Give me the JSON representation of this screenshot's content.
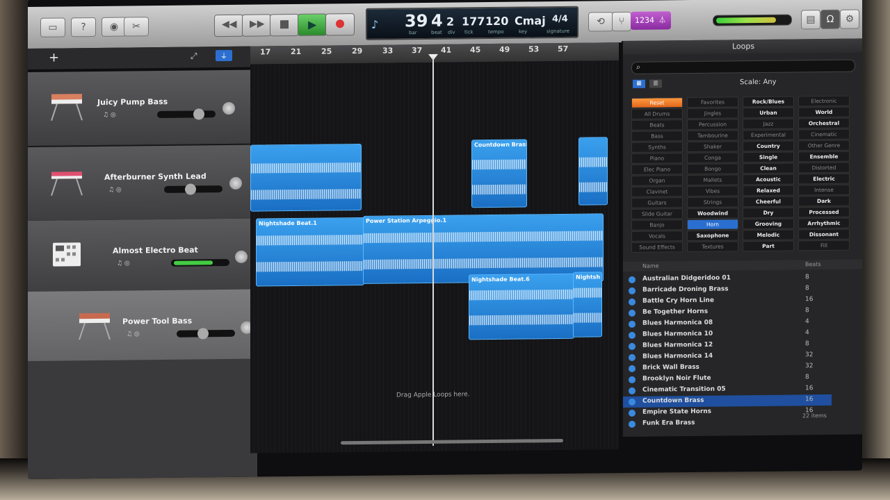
{
  "toolbar": {
    "lcd": {
      "bar": "39",
      "beat": "4",
      "div": "2",
      "tick": "177",
      "tempo": "120",
      "key": "Cmaj",
      "signature": "4/4",
      "bar_lbl": "bar",
      "beat_lbl": "beat",
      "div_lbl": "div",
      "tick_lbl": "tick",
      "tempo_lbl": "tempo",
      "key_lbl": "key",
      "sig_lbl": "signature"
    },
    "count_in": "1234"
  },
  "tracks": [
    {
      "name": "Juicy Pump Bass"
    },
    {
      "name": "Afterburner Synth Lead"
    },
    {
      "name": "Almost Electro Beat"
    },
    {
      "name": "Power Tool Bass"
    }
  ],
  "ruler": [
    "17",
    "21",
    "25",
    "29",
    "33",
    "37",
    "41",
    "45",
    "49",
    "53",
    "57"
  ],
  "regions": {
    "countdown": "Countdown Brass",
    "nightshade1": "Nightshade Beat.1",
    "power_station": "Power Station Arpeggio.1",
    "nightshade6": "Nightshade Beat.6",
    "nightsh": "Nightsh"
  },
  "drag_hint": "Drag Apple Loops here.",
  "loops": {
    "title": "Loops",
    "scale_label": "Scale:",
    "scale_value": "Any",
    "keywords": [
      [
        "Reset",
        "Favorites",
        "Rock/Blues",
        "Electronic"
      ],
      [
        "All Drums",
        "Jingles",
        "Urban",
        "World"
      ],
      [
        "Beats",
        "Percussion",
        "Jazz",
        "Orchestral"
      ],
      [
        "Bass",
        "Tambourine",
        "Experimental",
        "Cinematic"
      ],
      [
        "Synths",
        "Shaker",
        "Country",
        "Other Genre"
      ],
      [
        "Piano",
        "Conga",
        "Single",
        "Ensemble"
      ],
      [
        "Elec Piano",
        "Bongo",
        "Clean",
        "Distorted"
      ],
      [
        "Organ",
        "Mallets",
        "Acoustic",
        "Electric"
      ],
      [
        "Clavinet",
        "Vibes",
        "Relaxed",
        "Intense"
      ],
      [
        "Guitars",
        "Strings",
        "Cheerful",
        "Dark"
      ],
      [
        "Slide Guitar",
        "Woodwind",
        "Dry",
        "Processed"
      ],
      [
        "Banjo",
        "Horn",
        "Grooving",
        "Arrhythmic"
      ],
      [
        "Vocals",
        "Saxophone",
        "Melodic",
        "Dissonant"
      ],
      [
        "Sound Effects",
        "Textures",
        "Part",
        "Fill"
      ]
    ],
    "list_headers": {
      "name": "Name",
      "beats": "Beats"
    },
    "list": [
      {
        "name": "Australian Didgeridoo 01",
        "beats": "8"
      },
      {
        "name": "Barricade Droning Brass",
        "beats": "8"
      },
      {
        "name": "Battle Cry Horn Line",
        "beats": "16"
      },
      {
        "name": "Be Together Horns",
        "beats": "8"
      },
      {
        "name": "Blues Harmonica 08",
        "beats": "4"
      },
      {
        "name": "Blues Harmonica 10",
        "beats": "4"
      },
      {
        "name": "Blues Harmonica 12",
        "beats": "8"
      },
      {
        "name": "Blues Harmonica 14",
        "beats": "32"
      },
      {
        "name": "Brick Wall Brass",
        "beats": "32"
      },
      {
        "name": "Brooklyn Noir Flute",
        "beats": "8"
      },
      {
        "name": "Cinematic Transition 05",
        "beats": "16"
      },
      {
        "name": "Countdown Brass",
        "beats": "16"
      },
      {
        "name": "Empire State Horns",
        "beats": "16"
      },
      {
        "name": "Funk Era Brass",
        "beats": ""
      }
    ],
    "item_count": "22 items"
  },
  "colors": {
    "region": "#1a6fc4",
    "reset": "#e0661a",
    "purple": "#8a2aa0"
  }
}
